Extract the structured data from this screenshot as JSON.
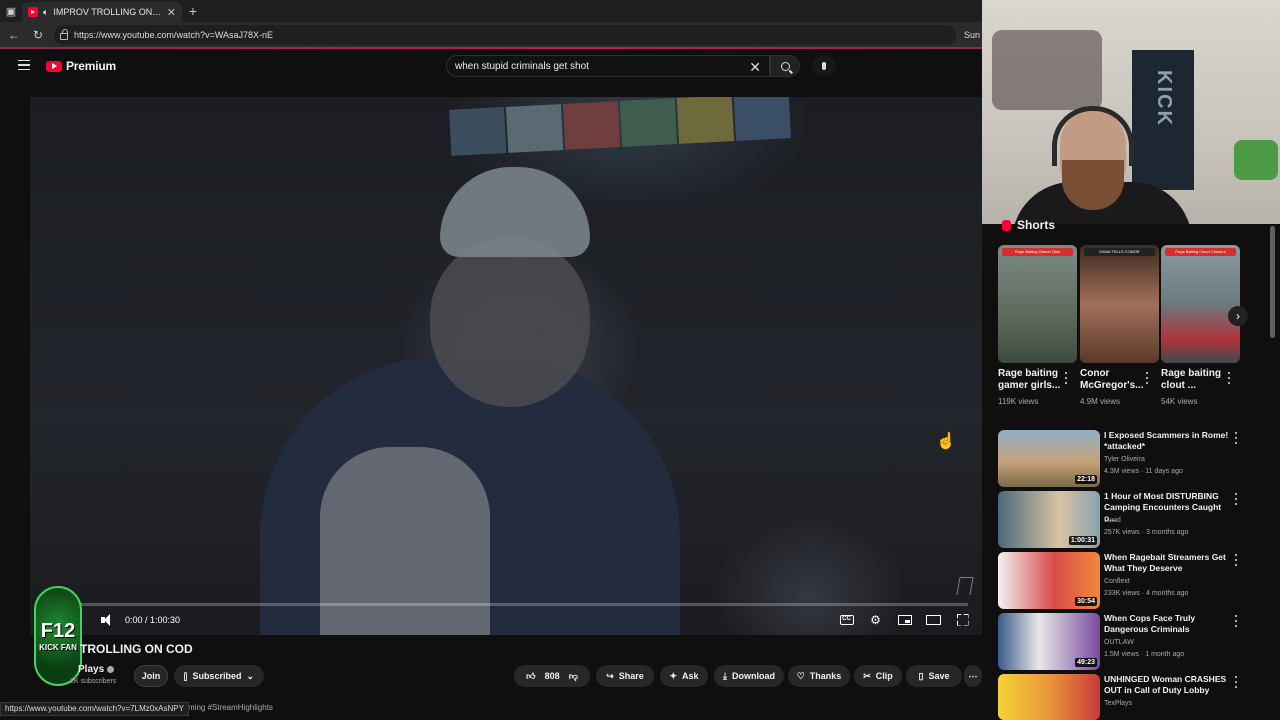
{
  "browser": {
    "tab_title": "IMPROV TROLLING ON COD",
    "url": "https://www.youtube.com/watch?v=WAsaJ78X-nE",
    "right_text": "Sun",
    "status_url": "https://www.youtube.com/watch?v=7LMz0xAsNPY"
  },
  "youtube": {
    "logo_text": "Premium",
    "search_query": "when stupid criminals get shot"
  },
  "player": {
    "time": "0:00 / 1:00:30"
  },
  "badge": {
    "line1": "F12",
    "line2": "KICK FAN"
  },
  "video": {
    "title": "TROLLING ON COD",
    "channel": "Plays",
    "subscribers": "2K subscribers",
    "hashtag": "ming #StreamHighlights"
  },
  "actions": {
    "join": "Join",
    "subscribed": "Subscribed",
    "likes": "808",
    "share": "Share",
    "ask": "Ask",
    "download": "Download",
    "thanks": "Thanks",
    "clip": "Clip",
    "save": "Save"
  },
  "shorts": {
    "label": "Shorts",
    "items": [
      {
        "banner": "Rage Baiting Gamer Girls",
        "title": "Rage baiting gamer girls...",
        "views": "119K views"
      },
      {
        "banner": "DANA TELLS CONOR",
        "title": "Conor McGregor's...",
        "views": "4.9M views"
      },
      {
        "banner": "Rage Baiting Cloud Chasers",
        "title": "Rage baiting clout ...",
        "views": "54K views"
      }
    ]
  },
  "recommendations": [
    {
      "title": "I Exposed Scammers in Rome! *attacked*",
      "channel": "Tyler Oliveira",
      "meta": "4.3M views · 11 days ago",
      "duration": "22:18"
    },
    {
      "title": "1 Hour of Most DISTURBING Camping Encounters Caught o...",
      "channel": "Lucid",
      "meta": "257K views · 3 months ago",
      "duration": "1:00:31"
    },
    {
      "title": "When Ragebait Streamers Get What They Deserve",
      "channel": "Conflext",
      "meta": "233K views · 4 months ago",
      "duration": "30:54"
    },
    {
      "title": "When Cops Face Truly Dangerous Criminals",
      "channel": "OUTLAW",
      "meta": "1.5M views · 1 month ago",
      "duration": "49:23"
    },
    {
      "title": "UNHINGED Woman CRASHES OUT in Call of Duty Lobby",
      "channel": "TexPlays",
      "meta": "",
      "duration": ""
    }
  ],
  "colors": {
    "accent": "#ff0033",
    "progress": "#ff0000",
    "badge": "#46d160"
  }
}
